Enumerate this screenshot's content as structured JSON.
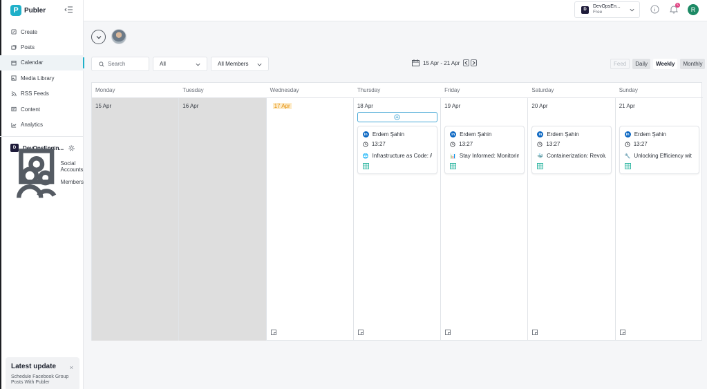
{
  "app": {
    "name": "Publer"
  },
  "sidebar": {
    "items": [
      {
        "label": "Create",
        "icon": "edit-icon"
      },
      {
        "label": "Posts",
        "icon": "posts-icon"
      },
      {
        "label": "Calendar",
        "icon": "calendar-icon",
        "active": true
      },
      {
        "label": "Media Library",
        "icon": "image-icon"
      },
      {
        "label": "RSS Feeds",
        "icon": "rss-icon"
      },
      {
        "label": "Content",
        "icon": "content-icon"
      },
      {
        "label": "Analytics",
        "icon": "analytics-icon"
      }
    ],
    "workspace": {
      "badge": "D",
      "name": "DevOpsEngin..."
    },
    "workspace_items": [
      {
        "label": "Social Accounts",
        "icon": "accounts-icon"
      },
      {
        "label": "Members",
        "icon": "members-icon"
      }
    ],
    "update": {
      "title": "Latest update",
      "close": "×",
      "body": "Schedule Facebook Group Posts With Publer"
    }
  },
  "topbar": {
    "account": {
      "badge": "D",
      "name": "DevOpsEn...",
      "plan": "Free"
    },
    "notifications_count": "5",
    "user_initial": "R"
  },
  "toolbar": {
    "search_placeholder": "Search",
    "filter_all": "All",
    "filter_members": "All Members",
    "date_range": "15 Apr - 21 Apr",
    "views": [
      {
        "label": "Feed",
        "state": "disabled"
      },
      {
        "label": "Daily",
        "state": "shade"
      },
      {
        "label": "Weekly",
        "state": "active"
      },
      {
        "label": "Monthly",
        "state": "shade"
      }
    ]
  },
  "calendar": {
    "weekdays": [
      "Monday",
      "Tuesday",
      "Wednesday",
      "Thursday",
      "Friday",
      "Saturday",
      "Sunday"
    ],
    "days": [
      {
        "date": "15 Apr",
        "past": true
      },
      {
        "date": "16 Apr",
        "past": true
      },
      {
        "date": "17 Apr",
        "today": true
      },
      {
        "date": "18 Apr"
      },
      {
        "date": "19 Apr"
      },
      {
        "date": "20 Apr"
      },
      {
        "date": "21 Apr"
      }
    ],
    "posts": [
      {
        "day": 3,
        "author": "Erdem Şahin",
        "time": "13:27",
        "emoji": "🌐",
        "text": "Infrastructure as Code: A"
      },
      {
        "day": 4,
        "author": "Erdem Şahin",
        "time": "13:27",
        "emoji": "📊",
        "text": "Stay Informed: Monitorin"
      },
      {
        "day": 5,
        "author": "Erdem Şahin",
        "time": "13:27",
        "emoji": "🐳",
        "text": "Containerization: Revolut"
      },
      {
        "day": 6,
        "author": "Erdem Şahin",
        "time": "13:27",
        "emoji": "🔧",
        "text": "Unlocking Efficiency wit"
      }
    ]
  }
}
